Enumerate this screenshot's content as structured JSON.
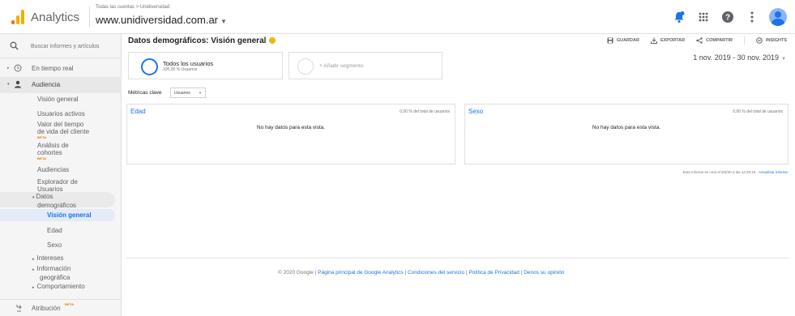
{
  "header": {
    "app_name": "Analytics",
    "breadcrumb": "Todas las cuentas > Unidiversidad",
    "property": "www.unidiversidad.com.ar"
  },
  "sidebar": {
    "search_placeholder": "Buscar informes y artículos",
    "realtime": "En tiempo real",
    "audience": "Audiencia",
    "items": [
      {
        "label": "Visión general"
      },
      {
        "label": "Usuarios activos"
      },
      {
        "label": "Valor del tiempo",
        "label2": "de vida del cliente",
        "beta": "BETA"
      },
      {
        "label": "Análisis de",
        "label2": "cohortes",
        "beta": "BETA"
      },
      {
        "label": "Audiencias"
      },
      {
        "label": "Explorador de",
        "label2": "Usuarios"
      },
      {
        "label": "Datos",
        "label2": "demográficos"
      }
    ],
    "sub_items": [
      "Visión general",
      "Edad",
      "Sexo"
    ],
    "more_items": [
      {
        "label": "Intereses"
      },
      {
        "label": "Información",
        "label2": "geográfica"
      },
      {
        "label": "Comportamiento"
      }
    ],
    "attribution": "Atribución",
    "attribution_beta": "BETA"
  },
  "main": {
    "title": "Datos demográficos: Visión general",
    "actions": {
      "save": "GUARDAR",
      "export": "EXPORTAR",
      "share": "COMPARTIR",
      "insights": "INSIGHTS"
    },
    "segment": {
      "name": "Todos los usuarios",
      "percent": "100,00 % Usuarios"
    },
    "add_segment": "+ Añadir segmento",
    "date_range": "1 nov. 2019 - 30 nov. 2019",
    "metrics_label": "Métricas clave",
    "metrics_select": "Usuarios",
    "cards": [
      {
        "title": "Edad",
        "share": "0,00 % del total de usuarios",
        "empty": "No hay datos para esta vista."
      },
      {
        "title": "Sexo",
        "share": "0,00 % del total de usuarios",
        "empty": "No hay datos para esta vista."
      }
    ],
    "created_text": "Este informe se creó el 9/3/20 a las 14:25:15 ·",
    "refresh_link": "Actualizar informe"
  },
  "footer": {
    "copyright": "© 2020 Google |",
    "links": [
      "Página principal de Google Analytics",
      "Condiciones del servicio",
      "Política de Privacidad",
      "Denos su opinión"
    ]
  },
  "colors": {
    "accent": "#1a73e8",
    "logo_orange": "#f9ab00",
    "logo_dark": "#e37400",
    "badge": "#f4b400"
  },
  "icons": [
    "analytics-logo-icon",
    "notifications-icon",
    "apps-icon",
    "help-icon",
    "more-vert-icon",
    "avatar",
    "search-icon",
    "clock-icon",
    "person-icon",
    "attribution-icon",
    "save-icon",
    "export-icon",
    "share-icon",
    "insights-icon",
    "verified-icon"
  ]
}
